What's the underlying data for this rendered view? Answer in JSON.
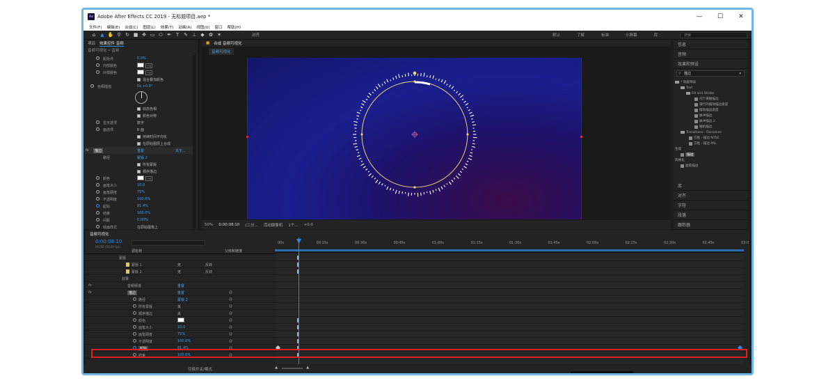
{
  "window": {
    "title": "Adobe After Effects CC 2019 - 无标题项目.aep *",
    "logo_text": "Ae",
    "minimize": "—",
    "maximize": "☐",
    "close": "✕"
  },
  "menu": [
    "文件(F)",
    "编辑(E)",
    "合成(C)",
    "图层(L)",
    "效果(T)",
    "动画(A)",
    "视图(V)",
    "窗口",
    "帮助(H)"
  ],
  "toolbar": {
    "tools": [
      "home-icon",
      "selection-icon",
      "hand-icon",
      "zoom-icon",
      "rotate-icon",
      "camera-icon",
      "pan-behind-icon",
      "rectangle-icon",
      "pen-icon",
      "text-icon",
      "brush-icon",
      "clone-icon",
      "eraser-icon",
      "roto-icon",
      "puppet-icon"
    ],
    "align_label": "对齐",
    "workspaces": [
      "默认",
      "了解",
      "标准",
      "小屏幕",
      "库"
    ],
    "search_placeholder": "搜索"
  },
  "left_panel": {
    "tab_project": "项目",
    "tab_effects": "效果控件 音频",
    "breadcrumb": "音频可视化 • 音频",
    "rows": [
      {
        "label": "起始点",
        "value": "0.0%",
        "indent": 16,
        "icon": "stopwatch"
      },
      {
        "label": "内部颜色",
        "value": "",
        "indent": 16,
        "icon": "stopwatch",
        "swatch": true
      },
      {
        "label": "外部颜色",
        "value": "",
        "indent": 16,
        "icon": "stopwatch",
        "swatch": true
      },
      {
        "label": "",
        "value": "混合叠加颜色",
        "indent": 16,
        "check": true
      },
      {
        "label": "色相插值",
        "value": "0x +0.0°",
        "indent": 8,
        "icon": "stopwatch"
      },
      {
        "label": "",
        "value": "",
        "indent": 16,
        "dial": true
      },
      {
        "label": "",
        "value": "动态色相",
        "indent": 16,
        "check": true
      },
      {
        "label": "",
        "value": "颜色对称",
        "indent": 16,
        "check": true
      },
      {
        "label": "显示选项",
        "value": "数字",
        "indent": 16,
        "icon": "stopwatch"
      },
      {
        "label": "面选项",
        "value": "B 面",
        "indent": 16,
        "icon": "stopwatch"
      },
      {
        "label": "",
        "value": "持续时间平均化",
        "indent": 16,
        "check": true
      },
      {
        "label": "",
        "value": "在原始图层上合成",
        "indent": 16,
        "check": true
      },
      {
        "label": "描边",
        "value": "重置",
        "indent": 2,
        "fx": true,
        "extra": "关于..."
      },
      {
        "label": "路径",
        "value": "蒙版 2",
        "indent": 16
      },
      {
        "label": "",
        "value": "所有蒙版",
        "indent": 16,
        "check": true
      },
      {
        "label": "",
        "value": "顺序描边",
        "indent": 16,
        "check": true
      },
      {
        "label": "颜色",
        "value": "",
        "indent": 16,
        "icon": "stopwatch",
        "swatch": true
      },
      {
        "label": "画笔大小",
        "value": "10.0",
        "indent": 16,
        "icon": "stopwatch"
      },
      {
        "label": "画笔硬度",
        "value": "75%",
        "indent": 16,
        "icon": "stopwatch"
      },
      {
        "label": "不透明度",
        "value": "100.0%",
        "indent": 16,
        "icon": "stopwatch"
      },
      {
        "label": "起始",
        "value": "81.4%",
        "indent": 16,
        "icon": "stopwatch-active"
      },
      {
        "label": "结束",
        "value": "100.0%",
        "indent": 16,
        "icon": "stopwatch"
      },
      {
        "label": "间距",
        "value": "0.00%",
        "indent": 16,
        "icon": "stopwatch"
      },
      {
        "label": "绘画样式",
        "value": "在原始图像上",
        "indent": 16,
        "icon": "stopwatch"
      }
    ]
  },
  "composition": {
    "tab_label": "合成 音频可视化",
    "sub_tab": "音频可视化",
    "footer": [
      "50%",
      "0:00:08:10",
      "(二分...",
      "活动摄像机",
      "1个...",
      "+0.0"
    ]
  },
  "right_panel": {
    "sections": [
      "信息",
      "音频",
      "效果和预设"
    ],
    "search_value": "描边",
    "tree": [
      {
        "text": "* 动画预设",
        "indent": 2,
        "folder": true
      },
      {
        "text": "Text",
        "indent": 10,
        "folder": true
      },
      {
        "text": "Fill and Stroke",
        "indent": 18,
        "folder": true
      },
      {
        "text": "闪下来缓描边",
        "indent": 30,
        "fx": true
      },
      {
        "text": "渐行的摆动描边宽度",
        "indent": 30,
        "fx": true
      },
      {
        "text": "摆动描边宽度",
        "indent": 30,
        "fx": true
      },
      {
        "text": "脉冲描边",
        "indent": 30,
        "fx": true
      },
      {
        "text": "脉冲描边 2",
        "indent": 30,
        "fx": true
      },
      {
        "text": "随机描边",
        "indent": 30,
        "fx": true
      },
      {
        "text": "Transitions - Dissolves",
        "indent": 10,
        "folder": true
      },
      {
        "text": "方框 - 描边 NTSC",
        "indent": 22,
        "fx": true
      },
      {
        "text": "方框 - 描边 PAL",
        "indent": 22,
        "fx": true
      },
      {
        "text": "生成",
        "indent": 2,
        "folder": false
      },
      {
        "text": "描边",
        "indent": 10,
        "fx": true,
        "selected": true
      },
      {
        "text": "风格化",
        "indent": 2,
        "folder": false
      },
      {
        "text": "画笔描边",
        "indent": 10,
        "fx": true
      }
    ],
    "bottom_sections": [
      "库",
      "对齐",
      "字符",
      "段落",
      "跟踪器"
    ]
  },
  "timeline": {
    "tab_label": "音频可视化",
    "timecode": "0:00:08:10",
    "timecode_sub": "00250 (30.00 fps)",
    "search_placeholder": "",
    "col_source": "源名称",
    "col_parent": "父级和链接",
    "ruler_labels": [
      "00s",
      "00:15s",
      "00:30s",
      "00:45s",
      "01:00s",
      "01:15s",
      "01:30s",
      "01:45s",
      "02:00s",
      "02:15s",
      "02:30s",
      "02:45s",
      "03:0"
    ],
    "rows": [
      {
        "name": "蒙版",
        "indent": 48,
        "value": ""
      },
      {
        "name": "蒙版 1",
        "indent": 66,
        "value": "无",
        "extra": "反转",
        "color": "#e6c84c"
      },
      {
        "name": "蒙版 2",
        "indent": 66,
        "value": "无",
        "extra": "反转",
        "color": "#e6c84c"
      },
      {
        "name": "效果",
        "indent": 52,
        "value": ""
      },
      {
        "name": "音频频谱",
        "indent": 60,
        "value": "重置",
        "fx": true
      },
      {
        "name": "描边",
        "indent": 60,
        "value": "重置",
        "fx": true,
        "selected": true
      },
      {
        "name": "路径",
        "indent": 76,
        "value": "蒙版 2"
      },
      {
        "name": "所有蒙版",
        "indent": 76,
        "value": "关"
      },
      {
        "name": "顺序描边",
        "indent": 76,
        "value": "关"
      },
      {
        "name": "颜色",
        "indent": 76,
        "value": "",
        "swatch": true
      },
      {
        "name": "画笔大小",
        "indent": 76,
        "value": "10.0"
      },
      {
        "name": "画笔硬度",
        "indent": 76,
        "value": "75%"
      },
      {
        "name": "不透明度",
        "indent": 76,
        "value": "100.0%"
      },
      {
        "name": "起始",
        "indent": 76,
        "value": "81.4%",
        "keyframed": true
      },
      {
        "name": "结束",
        "indent": 76,
        "value": "100.0%"
      }
    ],
    "footer_label": "切换开关/模式"
  },
  "colors": {
    "accent": "#2d8ceb",
    "highlight": "#e02020",
    "ring": "#e9d37a",
    "frame": "#6fb7ea"
  }
}
